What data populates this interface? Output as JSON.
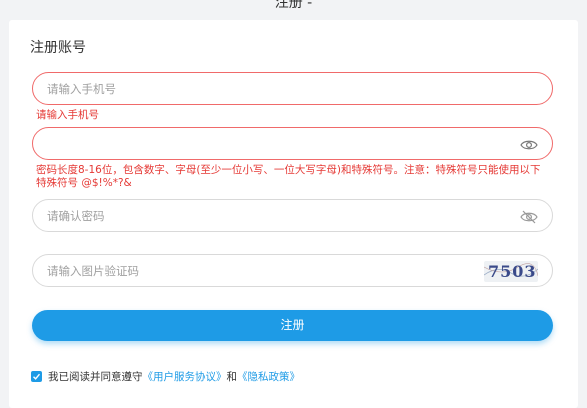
{
  "header": {
    "title": "注册 -"
  },
  "form": {
    "title": "注册账号",
    "phone": {
      "placeholder": "请输入手机号",
      "value": "",
      "error": "请输入手机号"
    },
    "password": {
      "placeholder": "",
      "value": "",
      "error": "密码长度8-16位，包含数字、字母(至少一位小写、一位大写字母)和特殊符号。注意：特殊符号只能使用以下特殊符号 @$!%*?&"
    },
    "confirm_password": {
      "placeholder": "请确认密码",
      "value": ""
    },
    "captcha": {
      "placeholder": "请输入图片验证码",
      "value": "",
      "image_text": "7503"
    },
    "submit_label": "注册",
    "agreement": {
      "checked": true,
      "prefix": "我已阅读并同意遵守",
      "terms_link": "《用户服务协议》",
      "conjunction": "和",
      "privacy_link": "《隐私政策》"
    }
  },
  "colors": {
    "accent": "#1e9be6",
    "error": "#e53935",
    "error_border": "#f06a6a"
  },
  "icons": {
    "password_eye": "eye-icon",
    "confirm_eye": "eye-off-icon",
    "checkbox": "checkmark-icon"
  }
}
